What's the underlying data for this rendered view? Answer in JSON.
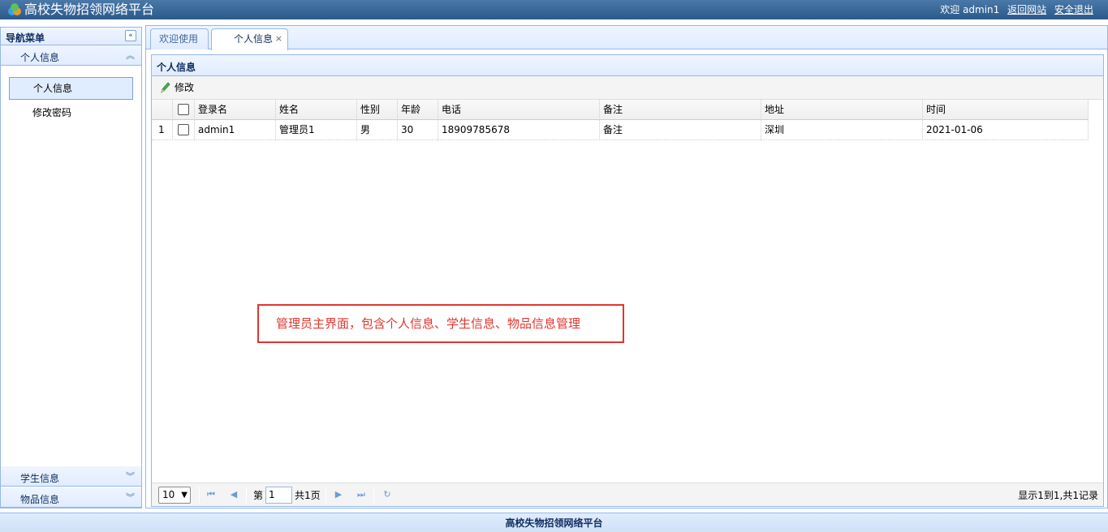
{
  "header": {
    "app_title": "高校失物招领网络平台",
    "welcome": "欢迎 admin1",
    "back_link": "返回网站",
    "logout_link": "安全退出"
  },
  "nav": {
    "title": "导航菜单",
    "sections": [
      {
        "label": "个人信息",
        "expanded": true,
        "items": [
          "个人信息",
          "修改密码"
        ]
      },
      {
        "label": "学生信息",
        "expanded": false
      },
      {
        "label": "物品信息",
        "expanded": false
      }
    ]
  },
  "tabs": [
    {
      "label": "欢迎使用",
      "active": false
    },
    {
      "label": "个人信息",
      "active": true,
      "closable": true
    }
  ],
  "panel": {
    "title": "个人信息",
    "toolbar": {
      "edit_label": "修改"
    }
  },
  "grid": {
    "columns": [
      "登录名",
      "姓名",
      "性别",
      "年龄",
      "电话",
      "备注",
      "地址",
      "时间"
    ],
    "rows": [
      {
        "index": "1",
        "cells": [
          "admin1",
          "管理员1",
          "男",
          "30",
          "18909785678",
          "备注",
          "深圳",
          "2021-01-06"
        ]
      }
    ]
  },
  "annotation": "管理员主界面，包含个人信息、学生信息、物品信息管理",
  "pager": {
    "page_size": "10",
    "page_prefix": "第",
    "page_number": "1",
    "page_total": "共1页",
    "info": "显示1到1,共1记录"
  },
  "footer": "高校失物招领网络平台"
}
